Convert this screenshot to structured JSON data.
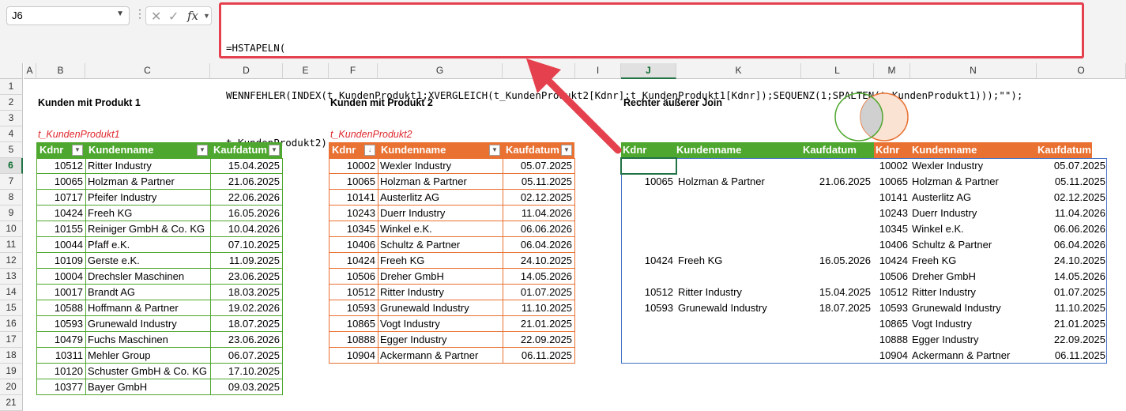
{
  "formula_bar": {
    "name_box": "J6",
    "fx_label": "fx",
    "formula_lines": [
      "=HSTAPELN(",
      "WENNFEHLER(INDEX(t_KundenProdukt1;XVERGLEICH(t_KundenProdukt2[Kdnr];t_KundenProdukt1[Kdnr]);SEQUENZ(1;SPALTEN(t_KundenProdukt1)));\"\");",
      "t_KundenProdukt2)"
    ]
  },
  "columns": [
    "A",
    "B",
    "C",
    "D",
    "E",
    "F",
    "G",
    "H",
    "I",
    "J",
    "K",
    "L",
    "M",
    "N",
    "O"
  ],
  "rows": [
    "1",
    "2",
    "3",
    "4",
    "5",
    "6",
    "7",
    "8",
    "9",
    "10",
    "11",
    "12",
    "13",
    "14",
    "15",
    "16",
    "17",
    "18",
    "19",
    "20",
    "21"
  ],
  "selected_cell": {
    "column": "J",
    "row": "6"
  },
  "table1": {
    "title": "Kunden mit Produkt 1",
    "name": "t_KundenProdukt1",
    "headers": [
      "Kdnr",
      "Kundenname",
      "Kaufdatum"
    ],
    "rows": [
      [
        "10512",
        "Ritter Industry",
        "15.04.2025"
      ],
      [
        "10065",
        "Holzman & Partner",
        "21.06.2025"
      ],
      [
        "10717",
        "Pfeifer Industry",
        "22.06.2026"
      ],
      [
        "10424",
        "Freeh KG",
        "16.05.2026"
      ],
      [
        "10155",
        "Reiniger GmbH & Co. KG",
        "10.04.2026"
      ],
      [
        "10044",
        "Pfaff e.K.",
        "07.10.2025"
      ],
      [
        "10109",
        "Gerste e.K.",
        "11.09.2025"
      ],
      [
        "10004",
        "Drechsler Maschinen",
        "23.06.2025"
      ],
      [
        "10017",
        "Brandt AG",
        "18.03.2025"
      ],
      [
        "10588",
        "Hoffmann & Partner",
        "19.02.2026"
      ],
      [
        "10593",
        "Grunewald Industry",
        "18.07.2025"
      ],
      [
        "10479",
        "Fuchs Maschinen",
        "23.06.2026"
      ],
      [
        "10311",
        "Mehler Group",
        "06.07.2025"
      ],
      [
        "10120",
        "Schuster GmbH & Co. KG",
        "17.10.2025"
      ],
      [
        "10377",
        "Bayer GmbH",
        "09.03.2025"
      ]
    ],
    "color": "#4ea72e"
  },
  "table2": {
    "title": "Kunden mit Produkt 2",
    "name": "t_KundenProdukt2",
    "headers": [
      "Kdnr",
      "Kundenname",
      "Kaufdatum"
    ],
    "rows": [
      [
        "10002",
        "Wexler Industry",
        "05.07.2025"
      ],
      [
        "10065",
        "Holzman & Partner",
        "05.11.2025"
      ],
      [
        "10141",
        "Austerlitz AG",
        "02.12.2025"
      ],
      [
        "10243",
        "Duerr Industry",
        "11.04.2026"
      ],
      [
        "10345",
        "Winkel e.K.",
        "06.06.2026"
      ],
      [
        "10406",
        "Schultz & Partner",
        "06.04.2026"
      ],
      [
        "10424",
        "Freeh KG",
        "24.10.2025"
      ],
      [
        "10506",
        "Dreher GmbH",
        "14.05.2026"
      ],
      [
        "10512",
        "Ritter Industry",
        "01.07.2025"
      ],
      [
        "10593",
        "Grunewald Industry",
        "11.10.2025"
      ],
      [
        "10865",
        "Vogt Industry",
        "21.01.2025"
      ],
      [
        "10888",
        "Egger Industry",
        "22.09.2025"
      ],
      [
        "10904",
        "Ackermann & Partner",
        "06.11.2025"
      ]
    ],
    "color": "#e97132"
  },
  "join": {
    "title": "Rechter äußerer Join",
    "headers_left": [
      "Kdnr",
      "Kundenname",
      "Kaufdatum"
    ],
    "headers_right": [
      "Kdnr",
      "Kundenname",
      "Kaufdatum"
    ],
    "rows": [
      [
        "",
        "",
        "",
        "10002",
        "Wexler Industry",
        "05.07.2025"
      ],
      [
        "10065",
        "Holzman & Partner",
        "21.06.2025",
        "10065",
        "Holzman & Partner",
        "05.11.2025"
      ],
      [
        "",
        "",
        "",
        "10141",
        "Austerlitz AG",
        "02.12.2025"
      ],
      [
        "",
        "",
        "",
        "10243",
        "Duerr Industry",
        "11.04.2026"
      ],
      [
        "",
        "",
        "",
        "10345",
        "Winkel e.K.",
        "06.06.2026"
      ],
      [
        "",
        "",
        "",
        "10406",
        "Schultz & Partner",
        "06.04.2026"
      ],
      [
        "10424",
        "Freeh KG",
        "16.05.2026",
        "10424",
        "Freeh KG",
        "24.10.2025"
      ],
      [
        "",
        "",
        "",
        "10506",
        "Dreher GmbH",
        "14.05.2026"
      ],
      [
        "10512",
        "Ritter Industry",
        "15.04.2025",
        "10512",
        "Ritter Industry",
        "01.07.2025"
      ],
      [
        "10593",
        "Grunewald Industry",
        "18.07.2025",
        "10593",
        "Grunewald Industry",
        "11.10.2025"
      ],
      [
        "",
        "",
        "",
        "10865",
        "Vogt Industry",
        "21.01.2025"
      ],
      [
        "",
        "",
        "",
        "10888",
        "Egger Industry",
        "22.09.2025"
      ],
      [
        "",
        "",
        "",
        "10904",
        "Ackermann & Partner",
        "06.11.2025"
      ]
    ]
  },
  "colors": {
    "accent_red": "#e5404d",
    "green": "#4ea72e",
    "orange": "#e97132",
    "selection": "#217346"
  }
}
